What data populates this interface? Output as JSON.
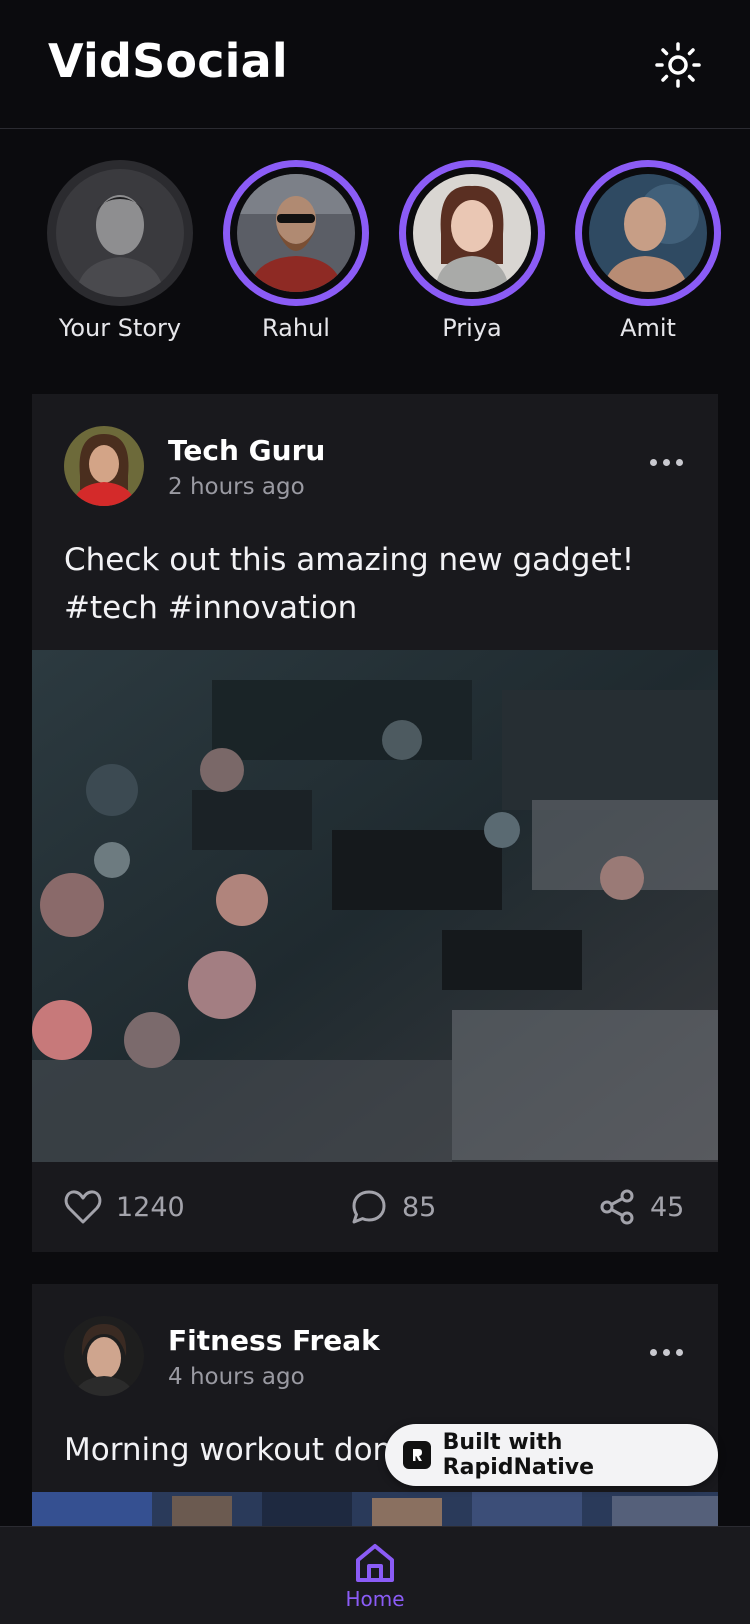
{
  "header": {
    "title": "VidSocial",
    "theme_icon": "sun-icon"
  },
  "stories": [
    {
      "name": "Your Story",
      "ring": false
    },
    {
      "name": "Rahul",
      "ring": true
    },
    {
      "name": "Priya",
      "ring": true
    },
    {
      "name": "Amit",
      "ring": true
    }
  ],
  "posts": [
    {
      "author": "Tech Guru",
      "time": "2 hours ago",
      "text": "Check out this amazing new gadget!\n#tech #innovation",
      "likes": "1240",
      "comments": "85",
      "shares": "45"
    },
    {
      "author": "Fitness Freak",
      "time": "4 hours ago",
      "text": "Morning workout don"
    }
  ],
  "nav": {
    "home_label": "Home"
  },
  "badge": {
    "label": "Built with RapidNative"
  },
  "colors": {
    "accent": "#8b5cf6",
    "background": "#0b0b0e",
    "card": "#19191d"
  }
}
